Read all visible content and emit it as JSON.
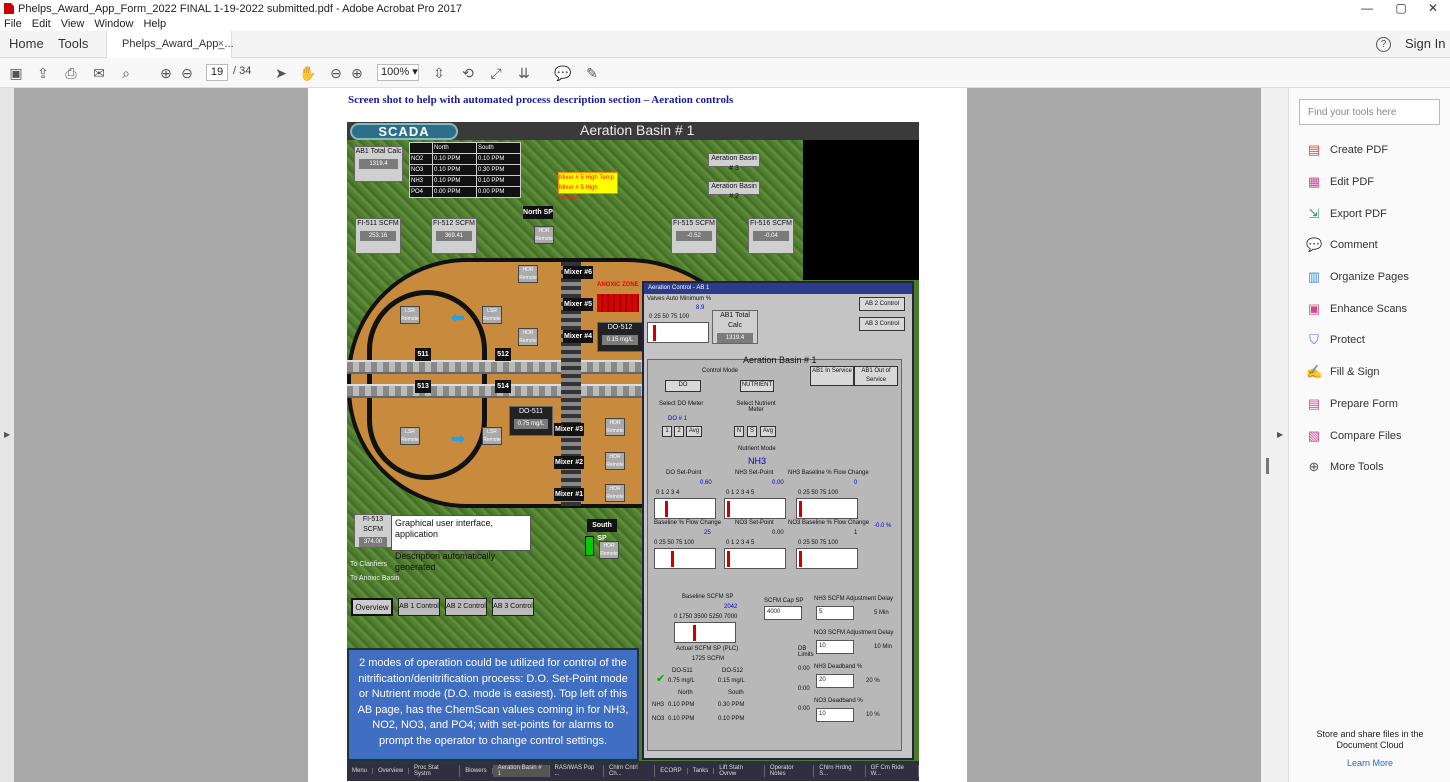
{
  "window": {
    "title": "Phelps_Award_App_Form_2022 FINAL 1-19-2022 submitted.pdf - Adobe Acrobat Pro 2017",
    "min": "—",
    "max": "▢",
    "close": "✕"
  },
  "menu": [
    "File",
    "Edit",
    "View",
    "Window",
    "Help"
  ],
  "tabs": {
    "home": "Home",
    "tools": "Tools",
    "doc": "Phelps_Award_App_...",
    "close": "×",
    "help": "?",
    "signin": "Sign In"
  },
  "toolbar": {
    "page": "19",
    "of": "/ 34",
    "zoom": "100%"
  },
  "doc": {
    "caption": "Screen shot to help with automated process description section – Aeration controls",
    "scada": {
      "logo": "SCADA",
      "title": "Aeration Basin # 1",
      "ab1": {
        "label": "AB1 Total Calc",
        "value": "1319.4"
      },
      "chem_header": [
        "",
        "North",
        "South"
      ],
      "chem_rows": [
        [
          "NO2",
          "0.10 PPM",
          "0.10 PPM"
        ],
        [
          "NO3",
          "0.10 PPM",
          "0.30 PPM"
        ],
        [
          "NH3",
          "0.10 PPM",
          "0.10 PPM"
        ],
        [
          "PO4",
          "0.00 PPM",
          "0.00 PPM"
        ]
      ],
      "alarm": [
        "Mixer # 5 High Temp",
        "Mixer # 5 High Moisture"
      ],
      "basin3": "Aeration Basin # 3",
      "basin2": "Aeration Basin # 2",
      "north_sp": "North SP",
      "south_sp": "South SP",
      "fi511": {
        "label": "FI-511 SCFM",
        "value": "253.16"
      },
      "fi512": {
        "label": "FI-512 SCFM",
        "value": "369.41"
      },
      "fi515": {
        "label": "FI-515 SCFM",
        "value": "-0.52"
      },
      "fi516": {
        "label": "FI-516 SCFM",
        "value": "-0.04"
      },
      "fi513": {
        "label": "FI-513 SCFM",
        "value": "374.00"
      },
      "mixers": [
        "Mixer #6",
        "Mixer #5",
        "Mixer #4",
        "Mixer #3",
        "Mixer #2",
        "Mixer #1"
      ],
      "anoxic": "ANOXIC ZONE",
      "do512": {
        "label": "DO-512",
        "value": "0.15 mg/L"
      },
      "do511": {
        "label": "DO-511",
        "value": "0.75 mg/L"
      },
      "valves": [
        "511",
        "512",
        "513",
        "514"
      ],
      "lsr": "LSR Remote",
      "hor": "HOR Remote",
      "tooltip": [
        "Graphical user interface, application",
        "Description automatically generated"
      ],
      "clarifiers": [
        "To Clarifiers",
        "To Anoxic Basin"
      ],
      "navtabs": [
        "Overview",
        "AB 1 Control",
        "AB 2 Control",
        "AB 3 Control"
      ],
      "note": "2 modes of operation could be utilized for control of the nitrification/denitrification process: D.O. Set-Point mode or Nutrient mode (D.O. mode is easiest). Top left of this AB page, has the ChemScan values coming in for NH3, NO2, NO3, and PO4; with set-points for alarms to prompt the operator to change control settings.",
      "bottom": [
        "Menu",
        "Overview",
        "Proc Stat Systm",
        "Blowers",
        "Aeration Basin # 1",
        "RAS/WAS Pop ...",
        "Chlrn Cntrl Ch...",
        "ECORP",
        "Tanks",
        "Lift Statn Ovrvw",
        "Operator Notes",
        "Chlrn Hrdng S...",
        "GF Cm Ride W..."
      ],
      "dialog": {
        "title": "Aeration Control - AB 1",
        "valves_min": "Valves Auto Minimum %",
        "valves_val": "8.9",
        "scale5": "0 25 50 75 100",
        "ab1calc": "AB1 Total Calc",
        "ab1calc_val": "1319.4",
        "ab2": "AB 2 Control",
        "ab3": "AB 3 Control",
        "basin": "Aeration Basin # 1",
        "in_service": "AB1 In Service",
        "out_service": "AB1 Out of Service",
        "control_mode": "Control Mode",
        "do_btn": "DO",
        "nutrient_btn": "NUTRIENT",
        "select_do": "Select DO Meter",
        "select_nutrient": "Select Nutrient Meter",
        "do_num": "DO # 1",
        "do_opts": [
          "1",
          "2",
          "Avg"
        ],
        "nut_opts": [
          "N",
          "S",
          "Avg"
        ],
        "nut_mode": "Nutrient Mode",
        "nh3": "NH3",
        "do_setpoint": "DO Set-Point",
        "do_setpoint_val": "0.60",
        "scale4": "0 1 2 3 4",
        "nh3_sp": "NH3 Set-Point",
        "nh3_sp_val": "0.00",
        "scale5b": "0 1 2 3 4 5",
        "nh3_flow": "NH3 Baseline % Flow Change",
        "nh3_flow_val": "0",
        "base_flow": "Baseline % Flow Change",
        "base_flow_val": "25",
        "no3_sp": "NO3 Set-Point",
        "no3_sp_val": "0.00",
        "no3_flow": "NO3 Baseline % Flow Change",
        "no3_flow_val": "1",
        "side_pct": "-0.0 %",
        "baseline_scfm": "Baseline SCFM SP",
        "baseline_val": "2042",
        "scale_scfm": "0 1750 3500 5250 7000",
        "actual_scfm": "Actual SCFM SP (PLC)",
        "actual_val": "1725 SCFM",
        "cap_sp": "SCFM Cap SP",
        "cap_val": "4000",
        "nh3_delay": "NH3 SCFM Adjustment Delay",
        "nh3_delay_val": "5",
        "min5": "5 Min",
        "no3_delay": "NO3 SCFM Adjustment Delay",
        "no3_delay_val": "10",
        "min10": "10 Min",
        "db_limits": "DB Limits",
        "nh3_dead": "NH3 Deadband %",
        "nh3_dead_val": "20",
        "pct20": "20 %",
        "no3_dead": "NO3 Deadband %",
        "no3_dead_val": "10",
        "pct10": "10 %",
        "times": [
          "0:00",
          "0:00",
          "0:00"
        ],
        "do511": "DO-511",
        "do511v": "0.75 mg/L",
        "do512": "DO-512",
        "do512v": "0.15 mg/L",
        "north": "North",
        "south": "South",
        "nh3n": "0.10 PPM",
        "nh3s": "0.30 PPM",
        "no3n": "0.10 PPM",
        "no3s": "0.10 PPM",
        "lbl_nh3": "NH3",
        "lbl_no3": "NO3"
      }
    }
  },
  "sidebar": {
    "find": "Find your tools here",
    "items": [
      {
        "label": "Create PDF",
        "icon": "create-pdf-icon",
        "color": "#e0413e"
      },
      {
        "label": "Edit PDF",
        "icon": "edit-pdf-icon",
        "color": "#d14a8c"
      },
      {
        "label": "Export PDF",
        "icon": "export-pdf-icon",
        "color": "#2c9b5a"
      },
      {
        "label": "Comment",
        "icon": "comment-icon",
        "color": "#e8b000"
      },
      {
        "label": "Organize Pages",
        "icon": "organize-pages-icon",
        "color": "#3a8fd9"
      },
      {
        "label": "Enhance Scans",
        "icon": "enhance-scans-icon",
        "color": "#d14a8c"
      },
      {
        "label": "Protect",
        "icon": "protect-icon",
        "color": "#3a6fd9"
      },
      {
        "label": "Fill & Sign",
        "icon": "fill-sign-icon",
        "color": "#7a5cd9"
      },
      {
        "label": "Prepare Form",
        "icon": "prepare-form-icon",
        "color": "#d14a8c"
      },
      {
        "label": "Compare Files",
        "icon": "compare-files-icon",
        "color": "#d14a8c"
      },
      {
        "label": "More Tools",
        "icon": "more-tools-icon",
        "color": "#555555"
      }
    ],
    "cloud": "Store and share files in the Document Cloud",
    "learn": "Learn More"
  }
}
